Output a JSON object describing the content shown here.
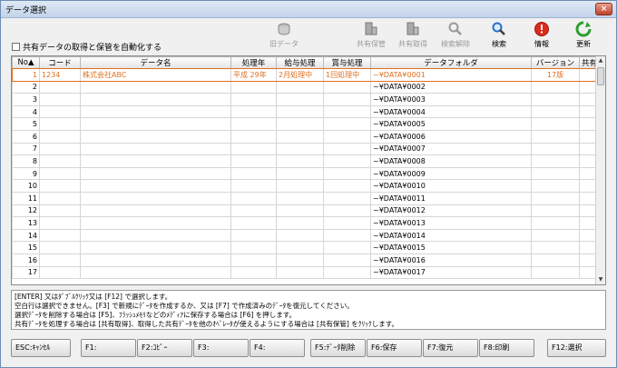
{
  "window": {
    "title": "データ選択",
    "close_label": "×"
  },
  "auto_option": {
    "label": "共有データの取得と保管を自動化する",
    "checked": false
  },
  "toolbar": {
    "old_data": "旧データ",
    "shared_store": "共有保管",
    "shared_get": "共有取得",
    "search_clear": "検索解除",
    "search": "検索",
    "info": "情報",
    "refresh": "更新"
  },
  "grid": {
    "headers": {
      "no": "No▲",
      "code": "コード",
      "name": "データ名",
      "year": "処理年",
      "salary": "給与処理",
      "bonus": "賞与処理",
      "folder": "データフォルダ",
      "version": "バージョン",
      "shared": "共有"
    },
    "rows": [
      {
        "no": "1",
        "code": "1234",
        "name": "株式会社ABC",
        "year": "平成 29年",
        "salary": "2月処理中",
        "bonus": "1回処理中",
        "folder": "~¥DATA¥0001",
        "version": "17版",
        "shared": ""
      },
      {
        "no": "2",
        "code": "",
        "name": "",
        "year": "",
        "salary": "",
        "bonus": "",
        "folder": "~¥DATA¥0002",
        "version": "",
        "shared": ""
      },
      {
        "no": "3",
        "code": "",
        "name": "",
        "year": "",
        "salary": "",
        "bonus": "",
        "folder": "~¥DATA¥0003",
        "version": "",
        "shared": ""
      },
      {
        "no": "4",
        "code": "",
        "name": "",
        "year": "",
        "salary": "",
        "bonus": "",
        "folder": "~¥DATA¥0004",
        "version": "",
        "shared": ""
      },
      {
        "no": "5",
        "code": "",
        "name": "",
        "year": "",
        "salary": "",
        "bonus": "",
        "folder": "~¥DATA¥0005",
        "version": "",
        "shared": ""
      },
      {
        "no": "6",
        "code": "",
        "name": "",
        "year": "",
        "salary": "",
        "bonus": "",
        "folder": "~¥DATA¥0006",
        "version": "",
        "shared": ""
      },
      {
        "no": "7",
        "code": "",
        "name": "",
        "year": "",
        "salary": "",
        "bonus": "",
        "folder": "~¥DATA¥0007",
        "version": "",
        "shared": ""
      },
      {
        "no": "8",
        "code": "",
        "name": "",
        "year": "",
        "salary": "",
        "bonus": "",
        "folder": "~¥DATA¥0008",
        "version": "",
        "shared": ""
      },
      {
        "no": "9",
        "code": "",
        "name": "",
        "year": "",
        "salary": "",
        "bonus": "",
        "folder": "~¥DATA¥0009",
        "version": "",
        "shared": ""
      },
      {
        "no": "10",
        "code": "",
        "name": "",
        "year": "",
        "salary": "",
        "bonus": "",
        "folder": "~¥DATA¥0010",
        "version": "",
        "shared": ""
      },
      {
        "no": "11",
        "code": "",
        "name": "",
        "year": "",
        "salary": "",
        "bonus": "",
        "folder": "~¥DATA¥0011",
        "version": "",
        "shared": ""
      },
      {
        "no": "12",
        "code": "",
        "name": "",
        "year": "",
        "salary": "",
        "bonus": "",
        "folder": "~¥DATA¥0012",
        "version": "",
        "shared": ""
      },
      {
        "no": "13",
        "code": "",
        "name": "",
        "year": "",
        "salary": "",
        "bonus": "",
        "folder": "~¥DATA¥0013",
        "version": "",
        "shared": ""
      },
      {
        "no": "14",
        "code": "",
        "name": "",
        "year": "",
        "salary": "",
        "bonus": "",
        "folder": "~¥DATA¥0014",
        "version": "",
        "shared": ""
      },
      {
        "no": "15",
        "code": "",
        "name": "",
        "year": "",
        "salary": "",
        "bonus": "",
        "folder": "~¥DATA¥0015",
        "version": "",
        "shared": ""
      },
      {
        "no": "16",
        "code": "",
        "name": "",
        "year": "",
        "salary": "",
        "bonus": "",
        "folder": "~¥DATA¥0016",
        "version": "",
        "shared": ""
      },
      {
        "no": "17",
        "code": "",
        "name": "",
        "year": "",
        "salary": "",
        "bonus": "",
        "folder": "~¥DATA¥0017",
        "version": "",
        "shared": ""
      }
    ]
  },
  "messages": [
    "[ENTER] 又はﾀﾞﾌﾞﾙｸﾘｯｸ又は [F12] で選択します。",
    "空白行は選択できません。[F3] で新規にﾃﾞｰﾀを作成するか、又は [F7] で作成済みのﾃﾞｰﾀを復元してください。",
    "選択ﾃﾞｰﾀを削除する場合は [F5]、ﾌﾗｯｼｭﾒﾓﾘなどのﾒﾃﾞｨｱに保存する場合は [F6] を押します。",
    "共有ﾃﾞｰﾀを処理する場合は [共有取得]、取得した共有ﾃﾞｰﾀを他のｵﾍﾟﾚｰﾀが使えるようにする場合は [共有保管] をｸﾘｯｸします。"
  ],
  "fkeys": {
    "esc": "ESC:ｷｬﾝｾﾙ",
    "f1": "F1:",
    "f2": "F2:ｺﾋﾟｰ",
    "f3": "F3:",
    "f4": "F4:",
    "f5": "F5:ﾃﾞｰﾀ削除",
    "f6": "F6:保存",
    "f7": "F7:復元",
    "f8": "F8:印刷",
    "f12": "F12:選択"
  }
}
